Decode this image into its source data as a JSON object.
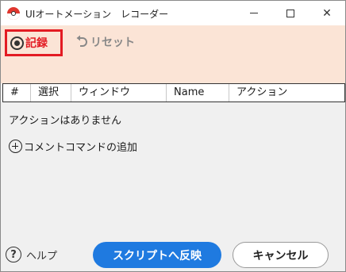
{
  "window": {
    "title": "UIオートメーション　レコーダー",
    "icons": {
      "app": "app-record-icon",
      "minimize": "minimize-icon",
      "maximize": "maximize-icon",
      "close": "close-icon"
    },
    "close_glyph": "✕"
  },
  "toolbar": {
    "record_label": "記録",
    "record_icon": "record-icon",
    "reset_label": "リセット",
    "reset_icon": "undo-icon",
    "accent_color": "#e31b23",
    "background_color": "#fbe4d6"
  },
  "table": {
    "columns": [
      "#",
      "選択",
      "ウィンドウ",
      "Name",
      "アクション"
    ]
  },
  "list": {
    "empty_message": "アクションはありません",
    "add_command_label": "コメントコマンドの追加",
    "add_icon": "plus-circle-icon"
  },
  "footer": {
    "help_label": "ヘルプ",
    "help_icon": "question-circle-icon",
    "help_glyph": "?",
    "apply_label": "スクリプトへ反映",
    "apply_color": "#1f7ae0",
    "cancel_label": "キャンセル"
  }
}
